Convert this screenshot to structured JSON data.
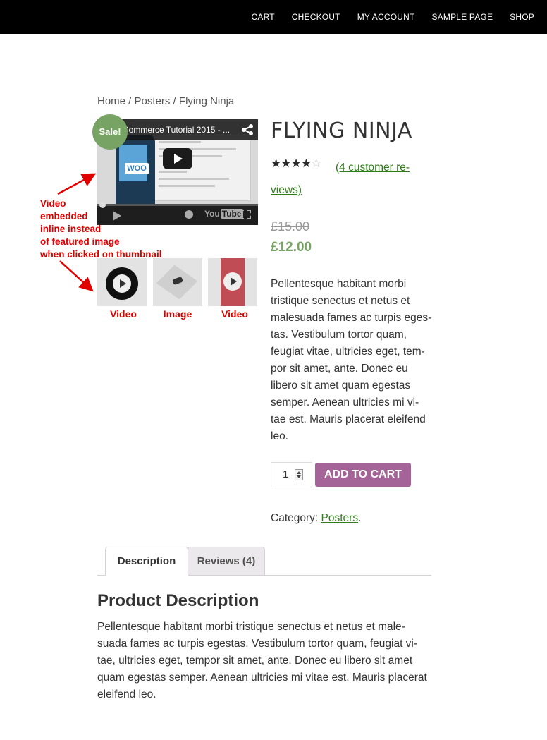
{
  "nav": {
    "items": [
      "CART",
      "CHECKOUT",
      "MY ACCOUNT",
      "SAMPLE PAGE",
      "SHOP"
    ]
  },
  "breadcrumb": {
    "home": "Home",
    "category": "Posters",
    "current": "Flying Ninja",
    "separator": " / "
  },
  "video": {
    "title": "Commerce Tutorial 2015 - ...",
    "logo_text": "WOO",
    "youtube_label": "You",
    "youtube_tube": "Tube"
  },
  "sale_badge": "Sale!",
  "thumbnails": [
    {
      "label": "Video",
      "icon": "video-play-icon"
    },
    {
      "label": "Image",
      "icon": "image-icon"
    },
    {
      "label": "Video",
      "icon": "video-play-icon"
    }
  ],
  "annotation": {
    "lines": [
      "Video",
      "embedded",
      "inline instead",
      "of featured image",
      "when clicked on thumbnail"
    ]
  },
  "product": {
    "title": "FLYING NINJA",
    "rating": 4,
    "rating_max": 5,
    "reviews_link": "(4 customer re-views)",
    "old_price": "£15.00",
    "new_price": "£12.00",
    "short_description": "Pellentesque habitant morbi tristique senectus et netus et malesuada fames ac turpis eges-tas. Vestibulum tortor quam, feugiat vitae, ultricies eget, tem-por sit amet, ante. Donec eu libero sit amet quam egestas semper. Aenean ultricies mi vi-tae est. Mauris placerat eleifend leo.",
    "quantity": "1",
    "add_to_cart": "ADD TO CART",
    "category_label": "Category: ",
    "category_link": "Posters",
    "category_end": "."
  },
  "tabs": [
    {
      "label": "Description",
      "active": true
    },
    {
      "label": "Reviews (4)",
      "active": false
    }
  ],
  "description": {
    "heading": "Product Description",
    "body": "Pellentesque habitant morbi tristique senectus et netus et male-suada fames ac turpis egestas. Vestibulum tortor quam, feugiat vi-tae, ultricies eget, tempor sit amet, ante. Donec eu libero sit amet quam egestas semper. Aenean ultricies mi vitae est. Mauris placerat eleifend leo."
  },
  "colors": {
    "topbar": "#000000",
    "sale_badge": "#77a464",
    "price": "#77a464",
    "link": "#2e7d19",
    "button": "#a46497",
    "annotation": "#e00000"
  }
}
